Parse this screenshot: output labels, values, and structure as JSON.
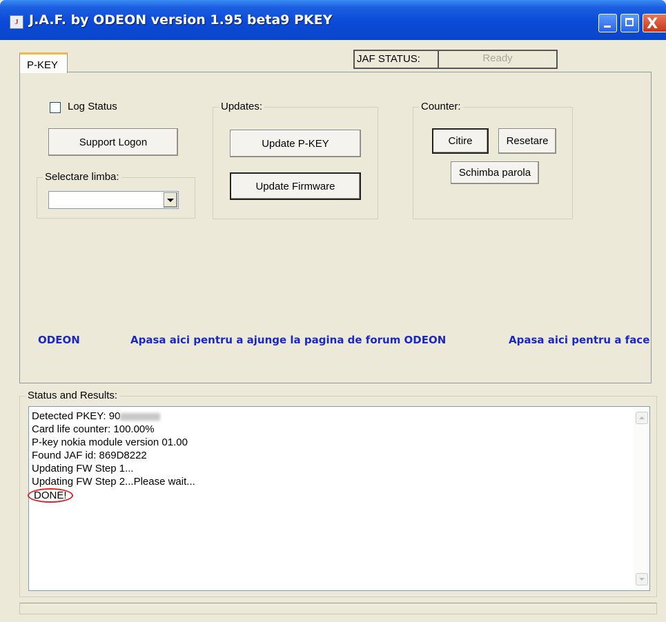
{
  "window": {
    "title": "J.A.F. by ODEON version 1.95 beta9 PKEY",
    "close_glyph": "X",
    "app_icon_glyph": "J"
  },
  "tabs": [
    {
      "label": "P-KEY",
      "active": true
    }
  ],
  "jaf_status": {
    "label": "JAF STATUS:",
    "value": "Ready"
  },
  "log_status": {
    "label": "Log Status",
    "checked": false
  },
  "support_logon": {
    "label": "Support Logon"
  },
  "language": {
    "legend": "Selectare limba:",
    "selected": ""
  },
  "updates": {
    "legend": "Updates:",
    "update_pkey": "Update P-KEY",
    "update_firmware": "Update Firmware"
  },
  "counter": {
    "legend": "Counter:",
    "citire": "Citire",
    "resetare": "Resetare",
    "schimba_parola": "Schimba parola"
  },
  "marquee": {
    "items": [
      "ODEON",
      "Apasa aici pentru a ajunge la pagina de forum ODEON",
      "Apasa aici pentru a face"
    ]
  },
  "status": {
    "legend": "Status and Results:",
    "lines": [
      "Detected PKEY: 90",
      "Card life counter: 100.00%",
      "P-key nokia module version 01.00",
      "Found JAF id: 869D8222",
      "Updating FW Step 1...",
      "Updating FW Step 2...Please wait..."
    ],
    "done": "DONE!"
  },
  "colors": {
    "titlebar": "#0a4ad8",
    "window_bg": "#ece9d8",
    "link_text": "#1a28c8",
    "done_circle": "#e0222a"
  }
}
